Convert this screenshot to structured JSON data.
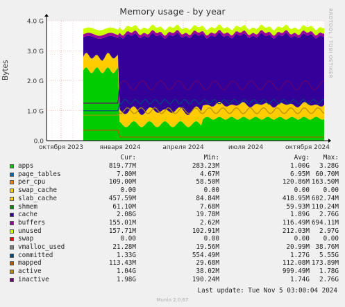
{
  "chart_data": {
    "type": "area",
    "title": "Memory usage - by year",
    "ylabel": "Bytes",
    "side_label": "RRDTOOL / TOBI OETIKER",
    "y_ticks": [
      "0.0",
      "1.0 G",
      "2.0 G",
      "3.0 G",
      "4.0 G"
    ],
    "ylim": [
      0,
      4.0
    ],
    "x_ticks": [
      "октября 2023",
      "января 2024",
      "апреля 2024",
      "июля 2024",
      "октября 2024"
    ],
    "grid": true,
    "colors": {
      "apps": "#00cc00",
      "page_tables": "#0066b3",
      "per_cpu": "#ff8000",
      "swap_cache": "#ffcc00",
      "slab_cache": "#ffcc00",
      "shmem": "#008f00",
      "cache": "#330099",
      "buffers": "#990099",
      "unused": "#ccff00",
      "swap": "#ff0000",
      "vmalloc_used": "#808080",
      "committed": "#00487d",
      "mapped": "#b35a00",
      "active": "#b38f00",
      "inactive": "#6b006b"
    },
    "series": [
      {
        "name": "apps",
        "cur": "819.77M",
        "min": "283.23M",
        "avg": "1.00G",
        "max": "3.28G"
      },
      {
        "name": "page_tables",
        "cur": "7.80M",
        "min": "4.67M",
        "avg": "6.95M",
        "max": "60.70M"
      },
      {
        "name": "per_cpu",
        "cur": "109.00M",
        "min": "58.50M",
        "avg": "120.86M",
        "max": "163.50M"
      },
      {
        "name": "swap_cache",
        "cur": "0.00",
        "min": "0.00",
        "avg": "0.00",
        "max": "0.00"
      },
      {
        "name": "slab_cache",
        "cur": "457.59M",
        "min": "84.84M",
        "avg": "418.95M",
        "max": "602.74M"
      },
      {
        "name": "shmem",
        "cur": "61.10M",
        "min": "7.68M",
        "avg": "59.93M",
        "max": "110.24M"
      },
      {
        "name": "cache",
        "cur": "2.08G",
        "min": "19.78M",
        "avg": "1.89G",
        "max": "2.76G"
      },
      {
        "name": "buffers",
        "cur": "155.01M",
        "min": "2.62M",
        "avg": "116.49M",
        "max": "694.11M"
      },
      {
        "name": "unused",
        "cur": "157.71M",
        "min": "102.91M",
        "avg": "212.03M",
        "max": "2.97G"
      },
      {
        "name": "swap",
        "cur": "0.00",
        "min": "0.00",
        "avg": "0.00",
        "max": "0.00"
      },
      {
        "name": "vmalloc_used",
        "cur": "21.28M",
        "min": "19.56M",
        "avg": "20.99M",
        "max": "38.76M"
      },
      {
        "name": "committed",
        "cur": "1.33G",
        "min": "554.49M",
        "avg": "1.27G",
        "max": "5.55G"
      },
      {
        "name": "mapped",
        "cur": "113.43M",
        "min": "29.68M",
        "avg": "112.08M",
        "max": "173.89M"
      },
      {
        "name": "active",
        "cur": "1.04G",
        "min": "38.02M",
        "avg": "999.49M",
        "max": "1.78G"
      },
      {
        "name": "inactive",
        "cur": "1.98G",
        "min": "190.24M",
        "avg": "1.74G",
        "max": "2.76G"
      }
    ]
  },
  "legend": {
    "col_cur": "Cur:",
    "col_min": "Min:",
    "col_avg": "Avg:",
    "col_max": "Max:"
  },
  "footer": {
    "last_update": "Last update:  Tue Nov  5 03:00:04 2024",
    "version": "Munin 2.0.67"
  }
}
